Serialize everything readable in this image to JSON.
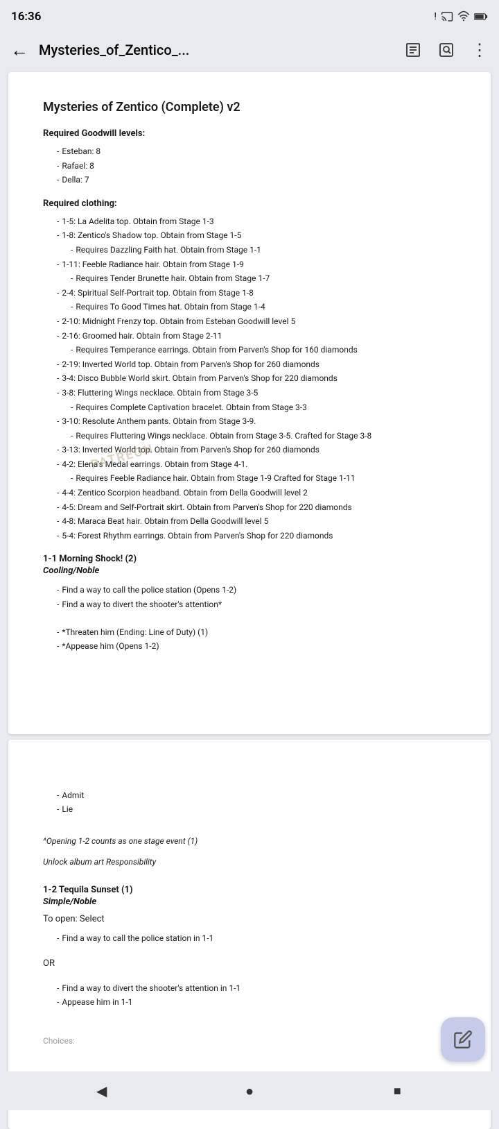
{
  "status_bar": {
    "time": "16:36",
    "icons": [
      "alert",
      "cast",
      "wifi",
      "battery"
    ]
  },
  "nav": {
    "title": "Mysteries_of_Zentico_...",
    "back_label": "back",
    "search_label": "search",
    "text_label": "text",
    "menu_label": "menu"
  },
  "page1": {
    "title": "Mysteries of Zentico (Complete) v2",
    "required_goodwill": {
      "heading": "Required Goodwill levels:",
      "items": [
        "Esteban: 8",
        "Rafael: 8",
        "Della: 7"
      ]
    },
    "required_clothing": {
      "heading": "Required clothing:",
      "items": [
        {
          "text": "1-5: La Adelita top. Obtain from Stage 1-3",
          "indent": 1
        },
        {
          "text": "1-8: Zentico's Shadow top. Obtain from Stage 1-5",
          "indent": 1
        },
        {
          "text": "Requires Dazzling Faith hat. Obtain from Stage 1-1",
          "indent": 2
        },
        {
          "text": "1-11: Feeble Radiance hair. Obtain from Stage 1-9",
          "indent": 1
        },
        {
          "text": "Requires Tender Brunette hair. Obtain from Stage 1-7",
          "indent": 2
        },
        {
          "text": "2-4: Spiritual Self-Portrait top. Obtain from Stage 1-8",
          "indent": 1
        },
        {
          "text": "Requires To Good Times hat. Obtain from Stage 1-4",
          "indent": 2
        },
        {
          "text": "2-10: Midnight Frenzy top. Obtain from Esteban Goodwill level 5",
          "indent": 1
        },
        {
          "text": "2-16: Groomed hair. Obtain from Stage 2-11",
          "indent": 1
        },
        {
          "text": "Requires Temperance earrings. Obtain from Parven's Shop for 160 diamonds",
          "indent": 2
        },
        {
          "text": "2-19: Inverted World top. Obtain from Parven's Shop for 260 diamonds",
          "indent": 1
        },
        {
          "text": "3-4: Disco Bubble World skirt. Obtain from Parven's Shop for 220 diamonds",
          "indent": 1
        },
        {
          "text": "3-8: Fluttering Wings necklace. Obtain from Stage 3-5",
          "indent": 1
        },
        {
          "text": "Requires Complete Captivation bracelet. Obtain from Stage 3-3",
          "indent": 2
        },
        {
          "text": "3-10: Resolute Anthem pants. Obtain from Stage 3-9.",
          "indent": 1
        },
        {
          "text": "Requires Fluttering Wings necklace. Obtain from Stage 3-5. Crafted for Stage 3-8",
          "indent": 2
        },
        {
          "text": "3-13: Inverted World top. Obtain from Parven's Shop for 260 diamonds",
          "indent": 1
        },
        {
          "text": "4-2: Elena's Medal earrings. Obtain from Stage 4-1.",
          "indent": 1
        },
        {
          "text": "Requires Feeble Radiance hair. Obtain from Stage 1-9 Crafted for Stage 1-11",
          "indent": 2
        },
        {
          "text": "4-4: Zentico Scorpion headband. Obtain from Della Goodwill level 2",
          "indent": 1
        },
        {
          "text": "4-5: Dream and Self-Portrait skirt. Obtain from Parven's Shop for 220 diamonds",
          "indent": 1
        },
        {
          "text": "4-8: Maraca Beat hair. Obtain from Della Goodwill level 5",
          "indent": 1
        },
        {
          "text": "5-4: Forest Rhythm earrings. Obtain from Parven's Shop for 220 diamonds",
          "indent": 1
        }
      ]
    },
    "stage1": {
      "heading": "1-1 Morning Shock! (2)",
      "subheading": "Cooling/Noble",
      "items": [
        {
          "text": "Find a way to call the police station (Opens 1-2)",
          "indent": 1
        },
        {
          "text": "Find a way to divert the shooter's attention*",
          "indent": 1
        },
        {
          "text": "*Threaten him (Ending: Line of Duty) (1)",
          "indent": 1
        },
        {
          "text": "*Appease him (Opens 1-2)",
          "indent": 1
        }
      ]
    }
  },
  "page2": {
    "items_top": [
      {
        "text": "Admit",
        "indent": 1
      },
      {
        "text": "Lie",
        "indent": 1
      }
    ],
    "note": "^Opening 1-2 counts as one stage event (1)",
    "unlock": "Unlock album art Responsibility",
    "stage2": {
      "heading": "1-2 Tequila Sunset (1)",
      "subheading": "Simple/Noble",
      "to_open": "To open: Select"
    },
    "stage2_items": [
      {
        "text": "Find a way to call the police station in 1-1",
        "indent": 1
      }
    ],
    "or_text": "OR",
    "stage2_items2": [
      {
        "text": "Find a way to divert the shooter's attention in 1-1",
        "indent": 1
      },
      {
        "text": "Appease him in 1-1",
        "indent": 1
      }
    ],
    "choices_label": "Choices:"
  },
  "bottom_nav": {
    "back": "back",
    "home": "home",
    "recents": "recents"
  },
  "fab": {
    "icon": "edit"
  },
  "watermark": "PATREON"
}
